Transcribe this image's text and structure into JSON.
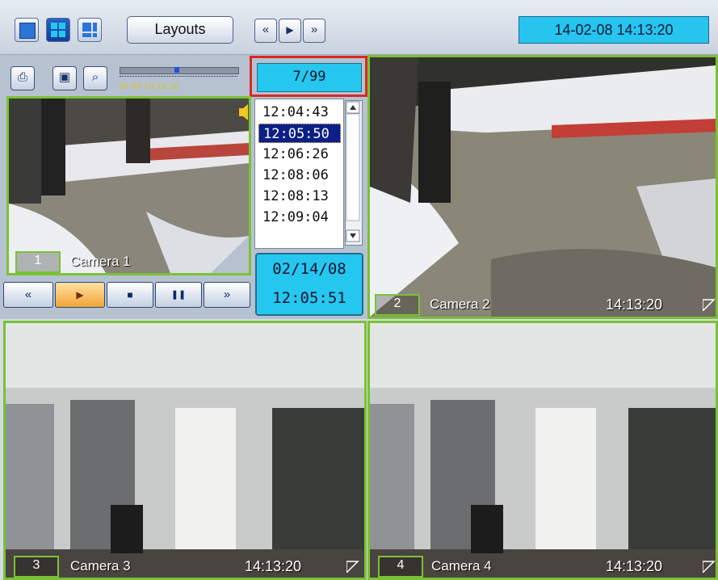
{
  "toolbar": {
    "layouts_label": "Layouts",
    "clock": "14-02-08   14:13:20",
    "play_prev": "«",
    "play_play": "▶",
    "play_next": "»"
  },
  "left_panel": {
    "print_glyph": "⎙",
    "save_glyph": "▣",
    "search_glyph": "⌕",
    "scale_numbers": "00 05  10  15  20",
    "counter": "7/99"
  },
  "time_list": {
    "items": [
      "12:04:43",
      "12:05:50",
      "12:06:26",
      "12:08:06",
      "12:08:13",
      "12:09:04"
    ],
    "selected_index": 1
  },
  "date_display": {
    "date": "02/14/08",
    "time": "12:05:51"
  },
  "controls": {
    "rewind": "«",
    "play": "▶",
    "stop": "■",
    "pause": "❚❚",
    "forward": "»"
  },
  "cameras": [
    {
      "number": "1",
      "name": "Camera 1",
      "time": ""
    },
    {
      "number": "2",
      "name": "Camera 2",
      "time": "14:13:20"
    },
    {
      "number": "3",
      "name": "Camera 3",
      "time": "14:13:20"
    },
    {
      "number": "4",
      "name": "Camera 4",
      "time": "14:13:20"
    }
  ],
  "colors": {
    "frame_border": "#7ac234",
    "display_cyan": "#26c7ef",
    "selection_navy": "#0c1f86",
    "counter_highlight": "#d72a23"
  },
  "icons": {
    "layout_single": "single-view-icon",
    "layout_quad": "quad-view-icon",
    "layout_mixed": "mixed-view-icon",
    "speaker": "speaker-icon"
  }
}
